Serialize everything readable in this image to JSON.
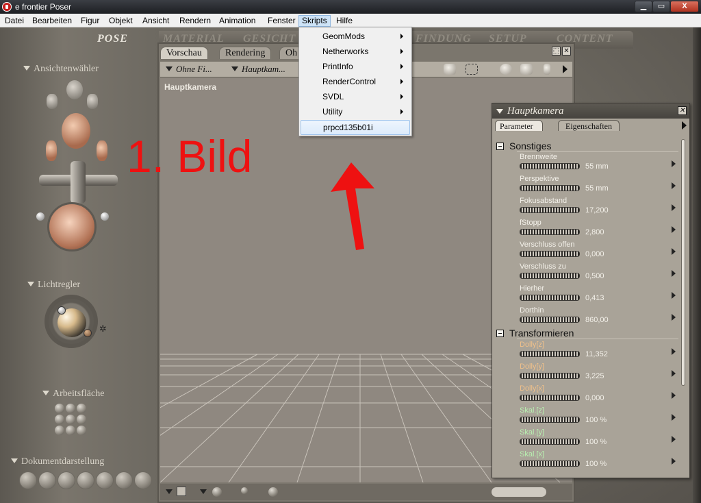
{
  "window": {
    "title": "e frontier Poser",
    "min": "▁",
    "max": "▭",
    "close": "X"
  },
  "menubar": [
    "Datei",
    "Bearbeiten",
    "Figur",
    "Objekt",
    "Ansicht",
    "Rendern",
    "Animation",
    "Fenster",
    "Skripts",
    "Hilfe"
  ],
  "rooms": {
    "pose": "POSE",
    "material": "MATERIAL",
    "gesicht": "GESICHT",
    "findung": "FINDUNG",
    "setup": "SETUP",
    "content": "CONTENT"
  },
  "left_panel": {
    "selector": "Ansichtenwähler",
    "lights": "Lichtregler",
    "workspace": "Arbeitsfläche",
    "document_display": "Dokumentdarstellung"
  },
  "document": {
    "tabs": [
      "Vorschau",
      "Rendering",
      "Oh"
    ],
    "dropdown_figure": "Ohne Fi...",
    "dropdown_camera": "Hauptkam...",
    "camera_label": "Hauptkamera",
    "btn_float": "⬚",
    "btn_close": "✕"
  },
  "annotation": {
    "text": "1. Bild",
    "color": "#ee1111"
  },
  "skripts_menu": {
    "items": [
      "GeomMods",
      "Netherworks",
      "PrintInfo",
      "RenderControl",
      "SVDL",
      "Utility"
    ],
    "highlighted": "prpcd135b01i"
  },
  "palette": {
    "title": "Hauptkamera",
    "close": "✕",
    "tabs": {
      "parameter": "Parameter",
      "eigenschaften": "Eigenschaften"
    },
    "groups": {
      "sonstiges": "Sonstiges",
      "transformieren": "Transformieren"
    },
    "sonstiges_params": [
      {
        "name": "Brennweite",
        "value": "55 mm"
      },
      {
        "name": "Perspektive",
        "value": "55 mm"
      },
      {
        "name": "Fokusabstand",
        "value": "17,200"
      },
      {
        "name": "fStopp",
        "value": "2,800"
      },
      {
        "name": "Verschluss offen",
        "value": "0,000"
      },
      {
        "name": "Verschluss zu",
        "value": "0,500"
      },
      {
        "name": "Hierher",
        "value": "0,413"
      },
      {
        "name": "Dorthin",
        "value": "860,00"
      }
    ],
    "transform_params": [
      {
        "name": "Dolly[z]",
        "value": "11,352",
        "color": "orange"
      },
      {
        "name": "Dolly[y]",
        "value": "3,225",
        "color": "orange"
      },
      {
        "name": "Dolly[x]",
        "value": "0,000",
        "color": "orange"
      },
      {
        "name": "Skal.[z]",
        "value": "100 %",
        "color": "green"
      },
      {
        "name": "Skal.[y]",
        "value": "100 %",
        "color": "green"
      },
      {
        "name": "Skal.[x]",
        "value": "100 %",
        "color": "green"
      }
    ]
  }
}
